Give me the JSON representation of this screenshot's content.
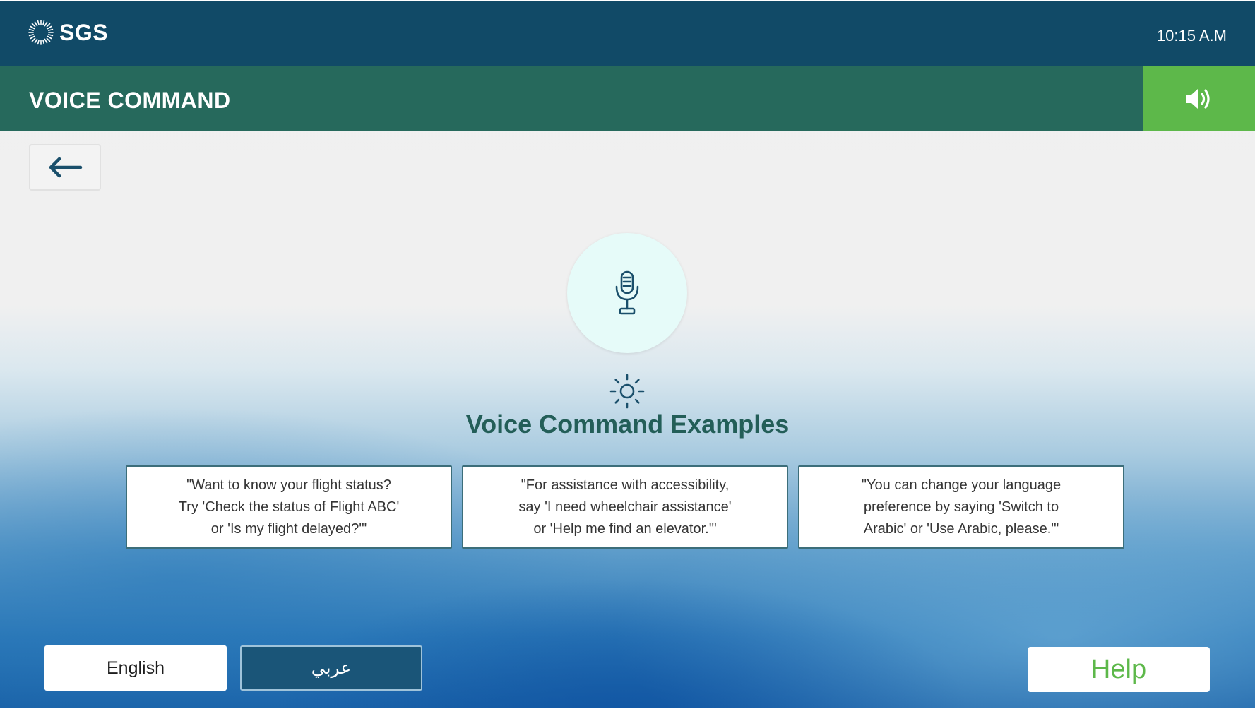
{
  "header": {
    "logo_text": "SGS",
    "time": "10:15 A.M"
  },
  "titlebar": {
    "title": "VOICE COMMAND",
    "sound_icon": "speaker-volume-icon"
  },
  "nav": {
    "back_icon": "arrow-left-icon"
  },
  "main": {
    "mic_icon": "microphone-icon",
    "sun_icon": "sun-icon",
    "heading": "Voice Command Examples",
    "examples": [
      "\"Want to know your flight status?\nTry 'Check the status of Flight ABC'\nor 'Is my flight delayed?'\"",
      "\"For assistance with accessibility,\nsay 'I need wheelchair assistance'\nor 'Help me find an elevator.'\"",
      "\"You can change your language\npreference by saying 'Switch to\nArabic' or 'Use Arabic, please.'\""
    ]
  },
  "footer": {
    "english_label": "English",
    "arabic_label": "عربي",
    "help_label": "Help"
  },
  "colors": {
    "header_bg": "#114a67",
    "titlebar_bg": "#26695c",
    "accent_green": "#5db84a",
    "heading_color": "#235e58"
  }
}
